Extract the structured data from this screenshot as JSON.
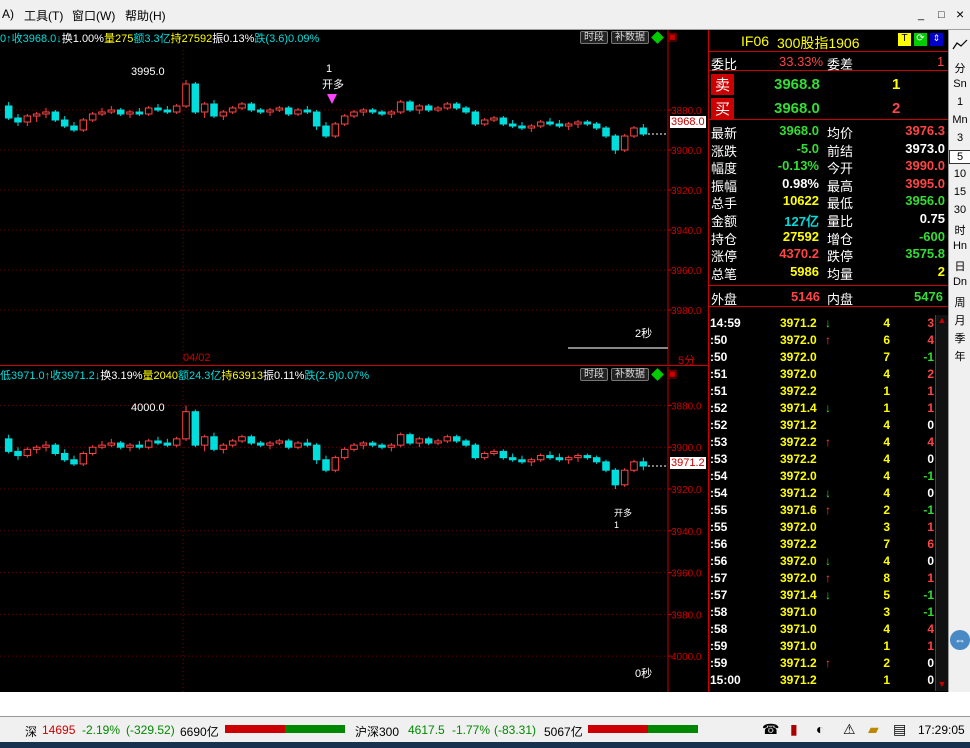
{
  "menu": {
    "item_a": "A)",
    "tools": "工具(T)",
    "window": "窗口(W)",
    "help": "帮助(H)"
  },
  "window_buttons": {
    "min": "_",
    "max": "□",
    "close": "×"
  },
  "chart_top": {
    "info_parts": [
      {
        "text": "0↑收3968.0↓",
        "color": "#00dddd"
      },
      {
        "text": "换1.00%",
        "color": "#ffffff"
      },
      {
        "text": "量275",
        "color": "#ffff00"
      },
      {
        "text": "额3.3亿",
        "color": "#00dddd"
      },
      {
        "text": "持27592",
        "color": "#ffff00"
      },
      {
        "text": "振0.13%",
        "color": "#ffffff"
      },
      {
        "text": "跌(3.6)0.09%",
        "color": "#00dddd"
      }
    ],
    "btn_period": "时段",
    "btn_fill": "补数据",
    "peak_label": "3995.0",
    "signal_label": "1",
    "signal_text": "开多",
    "y_ticks": [
      "3980.0",
      "3960.0",
      "3940.0",
      "3920.0",
      "3900.0",
      "3880.0"
    ],
    "y_min": 3870,
    "y_max": 4000,
    "last_price": "3968.0",
    "date_label": "04/02",
    "period_label": "5分",
    "seconds_label": "2秒"
  },
  "chart_bottom": {
    "info_parts": [
      {
        "text": "低3971.0↑收3971.2↓",
        "color": "#00dddd"
      },
      {
        "text": "换3.19%",
        "color": "#ffffff"
      },
      {
        "text": "量2040",
        "color": "#ffff00"
      },
      {
        "text": "额24.3亿",
        "color": "#00dddd"
      },
      {
        "text": "持63913",
        "color": "#ffff00"
      },
      {
        "text": "振0.11%",
        "color": "#ffffff"
      },
      {
        "text": "跌(2.6)0.07%",
        "color": "#00dddd"
      }
    ],
    "btn_period": "时段",
    "btn_fill": "补数据",
    "peak_label": "4000.0",
    "signal_text": "开多",
    "signal_count": "1",
    "y_ticks": [
      "4000.0",
      "3980.0",
      "3960.0",
      "3940.0",
      "3920.0",
      "3900.0",
      "3880.0"
    ],
    "y_min": 3870,
    "y_max": 4005,
    "last_price": "3971.2",
    "seconds_label": "0秒"
  },
  "quote": {
    "code": "IF06",
    "name": "300股指1906",
    "weibi_label": "委比",
    "weibi": "33.33%",
    "weicha_label": "委差",
    "weicha": "1",
    "sell_label": "卖",
    "sell_price": "3968.8",
    "sell_vol": "1",
    "buy_label": "买",
    "buy_price": "3968.0",
    "buy_vol": "2",
    "rows": [
      {
        "l1": "最新",
        "v1": "3968.0",
        "c1": "#33dd33",
        "l2": "均价",
        "v2": "3976.3",
        "c2": "#ff4444"
      },
      {
        "l1": "涨跌",
        "v1": "-5.0",
        "c1": "#33dd33",
        "l2": "前结",
        "v2": "3973.0",
        "c2": "#ffffff"
      },
      {
        "l1": "幅度",
        "v1": "-0.13%",
        "c1": "#33dd33",
        "l2": "今开",
        "v2": "3990.0",
        "c2": "#ff4444"
      },
      {
        "l1": "振幅",
        "v1": "0.98%",
        "c1": "#ffffff",
        "l2": "最高",
        "v2": "3995.0",
        "c2": "#ff4444"
      },
      {
        "l1": "总手",
        "v1": "10622",
        "c1": "#ffff00",
        "l2": "最低",
        "v2": "3956.0",
        "c2": "#33dd33"
      },
      {
        "l1": "金额",
        "v1": "127亿",
        "c1": "#00dddd",
        "l2": "量比",
        "v2": "0.75",
        "c2": "#ffffff"
      },
      {
        "l1": "持仓",
        "v1": "27592",
        "c1": "#ffff00",
        "l2": "增仓",
        "v2": "-600",
        "c2": "#33dd33"
      },
      {
        "l1": "涨停",
        "v1": "4370.2",
        "c1": "#ff4444",
        "l2": "跌停",
        "v2": "3575.8",
        "c2": "#33dd33"
      },
      {
        "l1": "总笔",
        "v1": "5986",
        "c1": "#ffff00",
        "l2": "均量",
        "v2": "2",
        "c2": "#ffff00"
      }
    ],
    "outer_label": "外盘",
    "outer": "5146",
    "inner_label": "内盘",
    "inner": "5476"
  },
  "ticks": [
    {
      "t": "14:59",
      "p": "3971.2",
      "a": "↓",
      "ac": "#33dd33",
      "v": "4",
      "d": "3",
      "dc": "#ff4444"
    },
    {
      "t": ":50",
      "p": "3972.0",
      "a": "↑",
      "ac": "#ff4444",
      "v": "6",
      "d": "4",
      "dc": "#ff4444"
    },
    {
      "t": ":50",
      "p": "3972.0",
      "a": "",
      "ac": "#ffffff",
      "v": "7",
      "d": "-1",
      "dc": "#33dd33"
    },
    {
      "t": ":51",
      "p": "3972.0",
      "a": "",
      "ac": "#ffffff",
      "v": "4",
      "d": "2",
      "dc": "#ff4444"
    },
    {
      "t": ":51",
      "p": "3972.2",
      "a": "",
      "ac": "#ffffff",
      "v": "1",
      "d": "1",
      "dc": "#ff4444"
    },
    {
      "t": ":52",
      "p": "3971.4",
      "a": "↓",
      "ac": "#33dd33",
      "v": "1",
      "d": "1",
      "dc": "#ff4444"
    },
    {
      "t": ":52",
      "p": "3971.2",
      "a": "",
      "ac": "#ffffff",
      "v": "4",
      "d": "0",
      "dc": "#ffffff"
    },
    {
      "t": ":53",
      "p": "3972.2",
      "a": "↑",
      "ac": "#ff4444",
      "v": "4",
      "d": "4",
      "dc": "#ff4444"
    },
    {
      "t": ":53",
      "p": "3972.2",
      "a": "",
      "ac": "#ffffff",
      "v": "4",
      "d": "0",
      "dc": "#ffffff"
    },
    {
      "t": ":54",
      "p": "3972.0",
      "a": "",
      "ac": "#ffffff",
      "v": "4",
      "d": "-1",
      "dc": "#33dd33"
    },
    {
      "t": ":54",
      "p": "3971.2",
      "a": "↓",
      "ac": "#33dd33",
      "v": "4",
      "d": "0",
      "dc": "#ffffff"
    },
    {
      "t": ":55",
      "p": "3971.6",
      "a": "↑",
      "ac": "#ff4444",
      "v": "2",
      "d": "-1",
      "dc": "#33dd33"
    },
    {
      "t": ":55",
      "p": "3972.0",
      "a": "",
      "ac": "#ffffff",
      "v": "3",
      "d": "1",
      "dc": "#ff4444"
    },
    {
      "t": ":56",
      "p": "3972.2",
      "a": "",
      "ac": "#ffffff",
      "v": "7",
      "d": "6",
      "dc": "#ff4444"
    },
    {
      "t": ":56",
      "p": "3972.0",
      "a": "↓",
      "ac": "#33dd33",
      "v": "4",
      "d": "0",
      "dc": "#ffffff"
    },
    {
      "t": ":57",
      "p": "3972.0",
      "a": "↑",
      "ac": "#ff4444",
      "v": "8",
      "d": "1",
      "dc": "#ff4444"
    },
    {
      "t": ":57",
      "p": "3971.4",
      "a": "↓",
      "ac": "#33dd33",
      "v": "5",
      "d": "-1",
      "dc": "#33dd33"
    },
    {
      "t": ":58",
      "p": "3971.0",
      "a": "",
      "ac": "#ffffff",
      "v": "3",
      "d": "-1",
      "dc": "#33dd33"
    },
    {
      "t": ":58",
      "p": "3971.0",
      "a": "",
      "ac": "#ffffff",
      "v": "4",
      "d": "4",
      "dc": "#ff4444"
    },
    {
      "t": ":59",
      "p": "3971.0",
      "a": "",
      "ac": "#ffffff",
      "v": "1",
      "d": "1",
      "dc": "#ff4444"
    },
    {
      "t": ":59",
      "p": "3971.2",
      "a": "↑",
      "ac": "#ff4444",
      "v": "2",
      "d": "0",
      "dc": "#ffffff"
    },
    {
      "t": "15:00",
      "p": "3971.2",
      "a": "",
      "ac": "#ffffff",
      "v": "1",
      "d": "0",
      "dc": "#ffffff"
    }
  ],
  "sidebar_items": [
    "分",
    "Sn",
    "1",
    "Mn",
    "3",
    "5",
    "10",
    "15",
    "30",
    "时",
    "Hn",
    "日",
    "Dn",
    "周",
    "月",
    "季",
    "年"
  ],
  "sidebar_active": "5",
  "status": {
    "sz_label": "深",
    "sz_index": "14695",
    "sz_pct": "-2.19%",
    "sz_chg": "(-329.52)",
    "sz_amt": "6690亿",
    "hs_label": "沪深300",
    "hs_index": "4617.5",
    "hs_pct": "-1.77%",
    "hs_chg": "(-83.31)",
    "hs_amt": "5067亿",
    "time": "17:29:05"
  },
  "chart_data": [
    {
      "type": "candlestick",
      "title": "",
      "ylim": [
        3870,
        4000
      ],
      "y_ticks": [
        3880,
        3900,
        3920,
        3940,
        3960,
        3980
      ],
      "candles": [
        [
          3982,
          3984,
          3975,
          3976
        ],
        [
          3976,
          3978,
          3972,
          3974
        ],
        [
          3974,
          3978,
          3972,
          3977
        ],
        [
          3977,
          3979,
          3974,
          3978
        ],
        [
          3978,
          3981,
          3976,
          3979
        ],
        [
          3979,
          3980,
          3974,
          3975
        ],
        [
          3975,
          3977,
          3971,
          3972
        ],
        [
          3972,
          3974,
          3969,
          3970
        ],
        [
          3970,
          3976,
          3969,
          3975
        ],
        [
          3975,
          3979,
          3974,
          3978
        ],
        [
          3978,
          3981,
          3977,
          3979
        ],
        [
          3979,
          3982,
          3978,
          3980
        ],
        [
          3980,
          3981,
          3977,
          3978
        ],
        [
          3978,
          3980,
          3976,
          3979
        ],
        [
          3979,
          3981,
          3977,
          3978
        ],
        [
          3978,
          3982,
          3977,
          3981
        ],
        [
          3981,
          3983,
          3979,
          3980
        ],
        [
          3980,
          3982,
          3978,
          3979
        ],
        [
          3979,
          3983,
          3978,
          3982
        ],
        [
          3982,
          3995,
          3981,
          3993
        ],
        [
          3993,
          3994,
          3978,
          3979
        ],
        [
          3979,
          3984,
          3976,
          3983
        ],
        [
          3983,
          3985,
          3976,
          3977
        ],
        [
          3977,
          3980,
          3975,
          3979
        ],
        [
          3979,
          3982,
          3978,
          3981
        ],
        [
          3981,
          3984,
          3980,
          3983
        ],
        [
          3983,
          3984,
          3979,
          3980
        ],
        [
          3980,
          3981,
          3978,
          3979
        ],
        [
          3979,
          3981,
          3977,
          3980
        ],
        [
          3980,
          3982,
          3979,
          3981
        ],
        [
          3981,
          3982,
          3977,
          3978
        ],
        [
          3978,
          3981,
          3977,
          3980
        ],
        [
          3980,
          3982,
          3978,
          3979
        ],
        [
          3979,
          3980,
          3970,
          3972
        ],
        [
          3972,
          3974,
          3966,
          3967
        ],
        [
          3967,
          3974,
          3966,
          3973
        ],
        [
          3973,
          3978,
          3972,
          3977
        ],
        [
          3977,
          3980,
          3976,
          3979
        ],
        [
          3979,
          3981,
          3977,
          3980
        ],
        [
          3980,
          3981,
          3978,
          3979
        ],
        [
          3979,
          3980,
          3977,
          3978
        ],
        [
          3978,
          3980,
          3976,
          3979
        ],
        [
          3979,
          3985,
          3978,
          3984
        ],
        [
          3984,
          3985,
          3979,
          3980
        ],
        [
          3980,
          3983,
          3978,
          3982
        ],
        [
          3982,
          3983,
          3979,
          3980
        ],
        [
          3980,
          3982,
          3979,
          3981
        ],
        [
          3981,
          3984,
          3980,
          3983
        ],
        [
          3983,
          3984,
          3980,
          3981
        ],
        [
          3981,
          3982,
          3978,
          3979
        ],
        [
          3979,
          3980,
          3972,
          3973
        ],
        [
          3973,
          3976,
          3972,
          3975
        ],
        [
          3975,
          3977,
          3974,
          3976
        ],
        [
          3976,
          3977,
          3972,
          3973
        ],
        [
          3973,
          3975,
          3971,
          3972
        ],
        [
          3972,
          3974,
          3970,
          3971
        ],
        [
          3971,
          3973,
          3969,
          3972
        ],
        [
          3972,
          3975,
          3971,
          3974
        ],
        [
          3974,
          3976,
          3972,
          3973
        ],
        [
          3973,
          3975,
          3971,
          3972
        ],
        [
          3972,
          3974,
          3970,
          3973
        ],
        [
          3973,
          3975,
          3971,
          3974
        ],
        [
          3974,
          3975,
          3972,
          3973
        ],
        [
          3973,
          3974,
          3970,
          3971
        ],
        [
          3971,
          3972,
          3966,
          3967
        ],
        [
          3967,
          3968,
          3958,
          3960
        ],
        [
          3960,
          3968,
          3959,
          3967
        ],
        [
          3967,
          3972,
          3966,
          3971
        ],
        [
          3971,
          3973,
          3967,
          3968
        ]
      ]
    },
    {
      "type": "candlestick",
      "title": "",
      "ylim": [
        3870,
        4005
      ],
      "y_ticks": [
        3880,
        3900,
        3920,
        3940,
        3960,
        3980,
        4000
      ],
      "candles": [
        [
          3984,
          3986,
          3977,
          3978
        ],
        [
          3978,
          3980,
          3974,
          3976
        ],
        [
          3976,
          3980,
          3975,
          3979
        ],
        [
          3979,
          3981,
          3977,
          3980
        ],
        [
          3980,
          3983,
          3978,
          3981
        ],
        [
          3981,
          3982,
          3976,
          3977
        ],
        [
          3977,
          3979,
          3973,
          3974
        ],
        [
          3974,
          3976,
          3971,
          3972
        ],
        [
          3972,
          3978,
          3971,
          3977
        ],
        [
          3977,
          3981,
          3976,
          3980
        ],
        [
          3980,
          3983,
          3979,
          3981
        ],
        [
          3981,
          3984,
          3980,
          3982
        ],
        [
          3982,
          3983,
          3979,
          3980
        ],
        [
          3980,
          3982,
          3978,
          3981
        ],
        [
          3981,
          3983,
          3979,
          3980
        ],
        [
          3980,
          3984,
          3979,
          3983
        ],
        [
          3983,
          3985,
          3981,
          3982
        ],
        [
          3982,
          3984,
          3980,
          3981
        ],
        [
          3981,
          3985,
          3980,
          3984
        ],
        [
          3984,
          4000,
          3983,
          3997
        ],
        [
          3997,
          3998,
          3980,
          3981
        ],
        [
          3981,
          3986,
          3978,
          3985
        ],
        [
          3985,
          3987,
          3978,
          3979
        ],
        [
          3979,
          3982,
          3977,
          3981
        ],
        [
          3981,
          3984,
          3980,
          3983
        ],
        [
          3983,
          3986,
          3982,
          3985
        ],
        [
          3985,
          3986,
          3981,
          3982
        ],
        [
          3982,
          3983,
          3980,
          3981
        ],
        [
          3981,
          3983,
          3979,
          3982
        ],
        [
          3982,
          3984,
          3981,
          3983
        ],
        [
          3983,
          3984,
          3979,
          3980
        ],
        [
          3980,
          3983,
          3979,
          3982
        ],
        [
          3982,
          3984,
          3980,
          3981
        ],
        [
          3981,
          3982,
          3972,
          3974
        ],
        [
          3974,
          3976,
          3968,
          3969
        ],
        [
          3969,
          3976,
          3968,
          3975
        ],
        [
          3975,
          3980,
          3974,
          3979
        ],
        [
          3979,
          3982,
          3978,
          3981
        ],
        [
          3981,
          3983,
          3979,
          3982
        ],
        [
          3982,
          3983,
          3980,
          3981
        ],
        [
          3981,
          3982,
          3979,
          3980
        ],
        [
          3980,
          3982,
          3978,
          3981
        ],
        [
          3981,
          3987,
          3980,
          3986
        ],
        [
          3986,
          3987,
          3981,
          3982
        ],
        [
          3982,
          3985,
          3980,
          3984
        ],
        [
          3984,
          3985,
          3981,
          3982
        ],
        [
          3982,
          3984,
          3981,
          3983
        ],
        [
          3983,
          3986,
          3982,
          3985
        ],
        [
          3985,
          3986,
          3982,
          3983
        ],
        [
          3983,
          3984,
          3980,
          3981
        ],
        [
          3981,
          3982,
          3974,
          3975
        ],
        [
          3975,
          3978,
          3974,
          3977
        ],
        [
          3977,
          3979,
          3976,
          3978
        ],
        [
          3978,
          3979,
          3974,
          3975
        ],
        [
          3975,
          3977,
          3973,
          3974
        ],
        [
          3974,
          3976,
          3972,
          3973
        ],
        [
          3973,
          3975,
          3971,
          3974
        ],
        [
          3974,
          3977,
          3973,
          3976
        ],
        [
          3976,
          3978,
          3974,
          3975
        ],
        [
          3975,
          3977,
          3973,
          3974
        ],
        [
          3974,
          3976,
          3972,
          3975
        ],
        [
          3975,
          3977,
          3973,
          3976
        ],
        [
          3976,
          3977,
          3974,
          3975
        ],
        [
          3975,
          3976,
          3972,
          3973
        ],
        [
          3973,
          3974,
          3968,
          3969
        ],
        [
          3969,
          3970,
          3960,
          3962
        ],
        [
          3962,
          3970,
          3961,
          3969
        ],
        [
          3969,
          3974,
          3968,
          3973
        ],
        [
          3973,
          3975,
          3969,
          3971
        ]
      ]
    }
  ]
}
